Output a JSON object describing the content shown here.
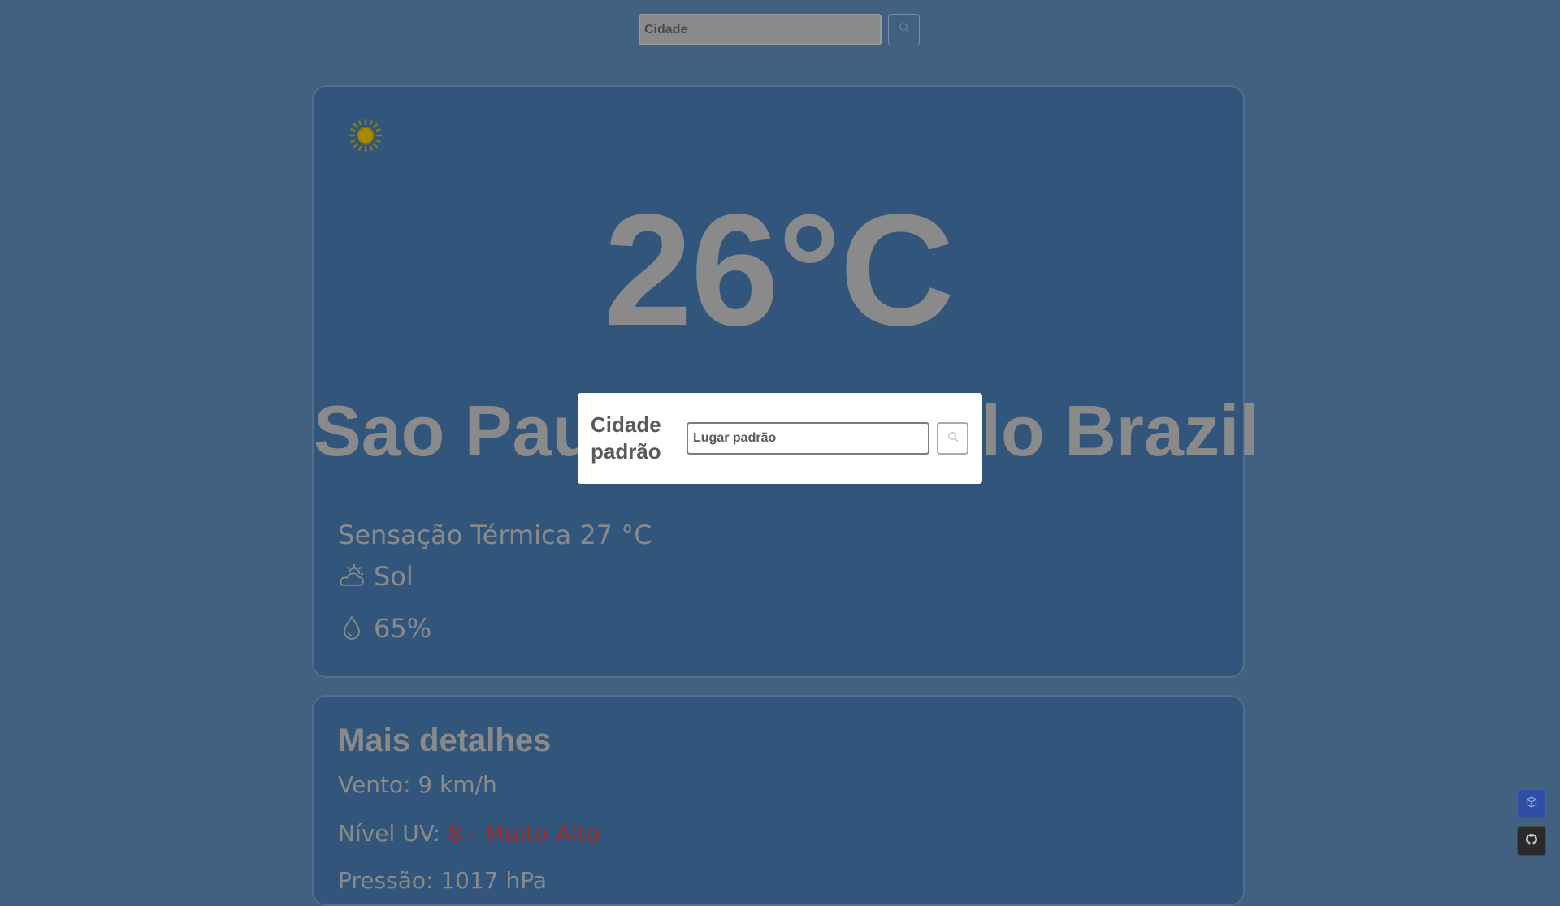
{
  "search": {
    "placeholder": "Cidade"
  },
  "weather": {
    "temperature": "26°C",
    "location": "Sao Paulo, Sao Paulo Brazil",
    "feels_like": "Sensação Térmica 27 °C",
    "condition": "Sol",
    "humidity": "65%"
  },
  "details": {
    "title": "Mais detalhes",
    "wind": "Vento: 9 km/h",
    "uv_label": "Nível UV: ",
    "uv_value": "8 - Muito Alto",
    "extra": "Pressão: 1017 hPa"
  },
  "modal": {
    "title": "Cidade padrão",
    "placeholder": "Lugar padrão"
  },
  "colors": {
    "background": "#42607f",
    "card": "#32557c",
    "uv_high": "#9c2e2e",
    "sun": "#c7a000"
  },
  "icons": {
    "search": "search-icon",
    "sun": "sun-icon",
    "condition": "partly-sunny-icon",
    "humidity": "droplet-icon",
    "cube": "cube-icon",
    "github": "github-icon"
  }
}
